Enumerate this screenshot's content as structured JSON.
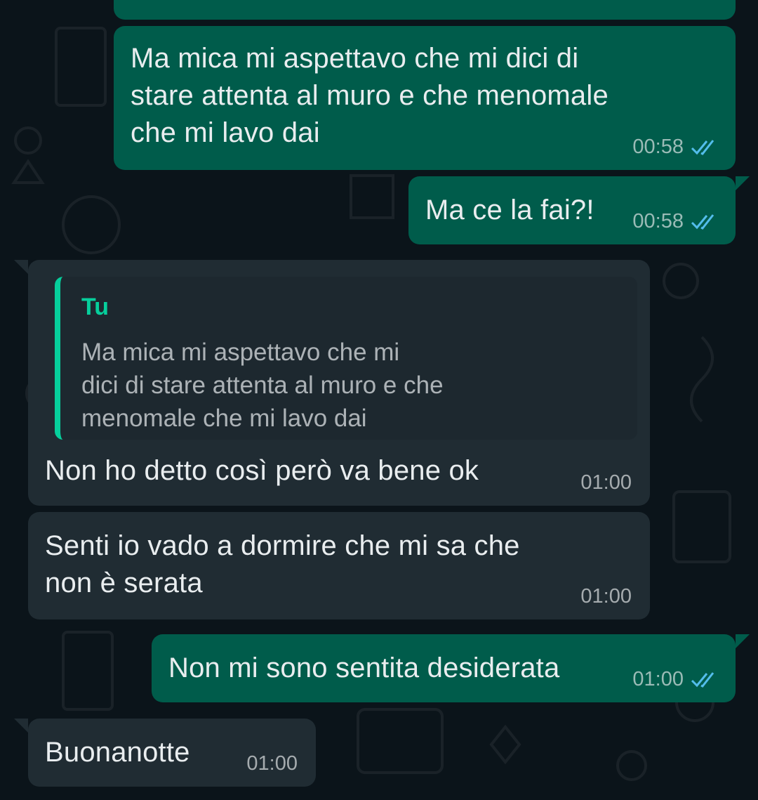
{
  "messages": [
    {
      "direction": "outgoing",
      "text": "Ma mica mi aspettavo che mi dici di\nstare attenta al muro e che menomale\nche mi lavo dai",
      "time": "00:58",
      "status": "read"
    },
    {
      "direction": "outgoing",
      "text": "Ma ce la fai?!",
      "time": "00:58",
      "status": "read"
    },
    {
      "direction": "incoming",
      "quote": {
        "author": "Tu",
        "text": "Ma mica mi aspettavo che mi\ndici di stare attenta al muro e che\nmenomale che mi lavo dai"
      },
      "text": "Non ho detto così però va bene ok",
      "time": "01:00"
    },
    {
      "direction": "incoming",
      "text": "Senti io vado a dormire che mi sa che\nnon è serata",
      "time": "01:00"
    },
    {
      "direction": "outgoing",
      "text": "Non mi sono sentita desiderata",
      "time": "01:00",
      "status": "read"
    },
    {
      "direction": "incoming",
      "text": "Buonanotte",
      "time": "01:00"
    }
  ],
  "colors": {
    "background": "#0b141a",
    "outgoing_bubble": "#005c4b",
    "incoming_bubble": "#202c33",
    "read_ticks": "#53bdeb",
    "quote_accent": "#06cf9c"
  },
  "icons": {
    "read_status": "double-check-icon"
  }
}
